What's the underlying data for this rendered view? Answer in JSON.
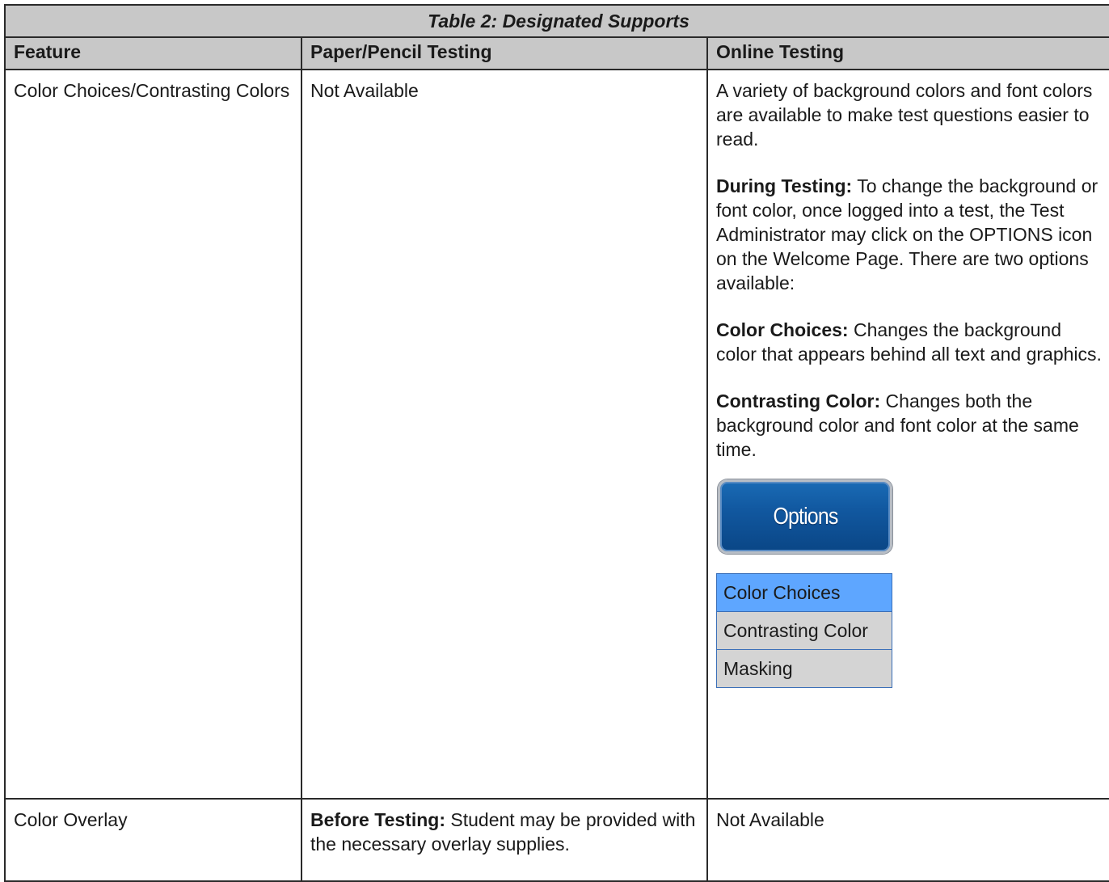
{
  "table": {
    "caption": "Table 2: Designated Supports",
    "headers": [
      "Feature",
      "Paper/Pencil Testing",
      "Online Testing"
    ],
    "rows": [
      {
        "feature": "Color Choices/Contrasting Colors",
        "paper": "Not Available",
        "online": {
          "intro": "A variety of background colors and font colors are available to make test questions easier to read.",
          "during_lead": "During Testing:",
          "during_text": " To change the background or font color, once logged into a test, the Test Administrator may click on the OPTIONS icon on the Welcome Page. There are two options available:",
          "choices_lead": "Color Choices:",
          "choices_text": " Changes the background color that appears behind all text and graphics.",
          "contrast_lead": "Contrasting Color:",
          "contrast_text": " Changes both the background color and font color at the same time.",
          "options_button": "Options",
          "menu_items": [
            "Color Choices",
            "Contrasting Color",
            "Masking"
          ]
        }
      },
      {
        "feature": "Color Overlay",
        "paper_lead": "Before Testing:",
        "paper_text": " Student may be provided with the necessary overlay supplies.",
        "online": "Not Available"
      }
    ]
  },
  "colors": {
    "header_bg": "#c8c8c8",
    "options_button": "#1158a0",
    "menu_selected": "#5ea6ff",
    "menu_item": "#d4d4d4"
  }
}
